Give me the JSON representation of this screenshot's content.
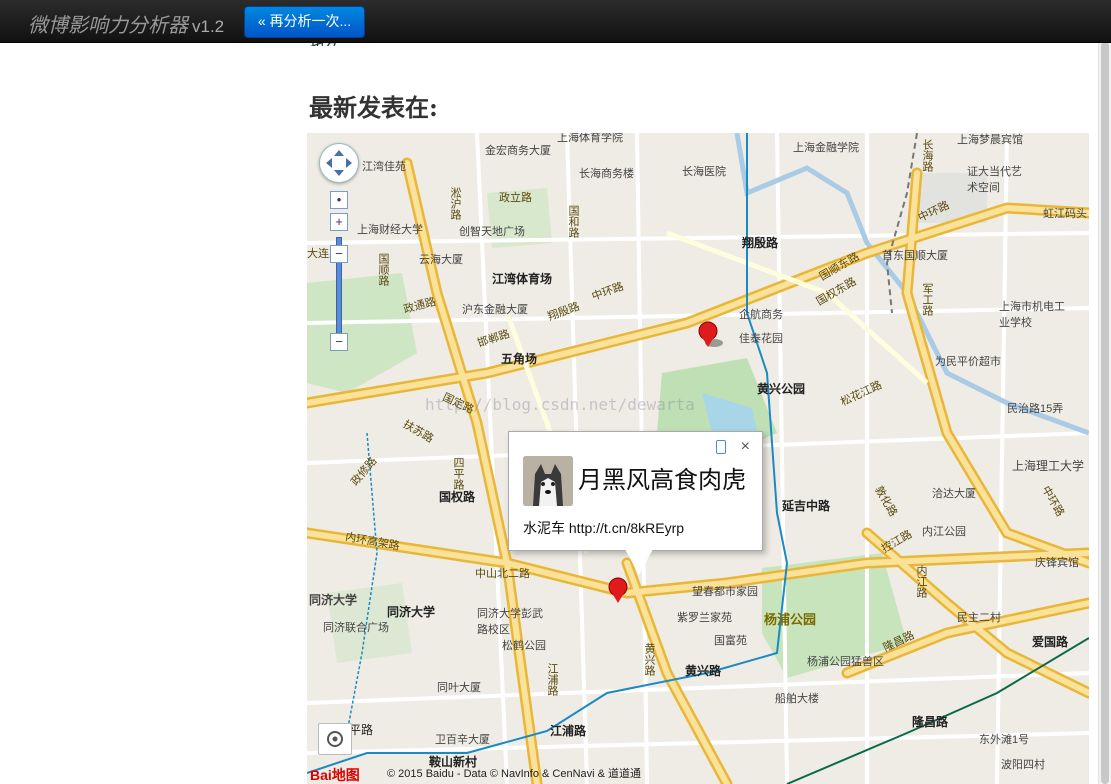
{
  "navbar": {
    "brand": "微博影响力分析器",
    "version": "v1.2",
    "again_button": "« 再分析一次..."
  },
  "page": {
    "cut_text": "也久",
    "section_title": "最新发表在:"
  },
  "map": {
    "watermark": "http://blog.csdn.net/dewarta",
    "pois": [
      "上海体育学院",
      "金宏商务大厦",
      "上海金融学院",
      "长海商务楼",
      "长海医院",
      "上海梦晨宾馆",
      "证大当代艺术空间",
      "江湾佳苑",
      "创智天地广场",
      "上海财经大学",
      "首东国顺大厦",
      "云海大厦",
      "沪东金融大厦",
      "企航商务",
      "佳泰花园",
      "上海市机电工业学校",
      "为民平价超市",
      "民治路15弄",
      "洽达大厦",
      "内江公园",
      "庆锋宾馆",
      "同济大学",
      "同济联合广场",
      "同济大学彭武路校区",
      "松鹤公园",
      "望春都市家园",
      "紫罗兰家苑",
      "国富苑",
      "杨浦公园",
      "杨浦公园猛兽区",
      "民主二村",
      "同叶大厦",
      "船舶大楼",
      "卫百辛大厦",
      "东外滩1号",
      "波阳四村",
      "虹江码头",
      "上海理工大学"
    ],
    "stations": [
      "江湾体育场",
      "五角场",
      "翔殷路",
      "黄兴公园",
      "国权路",
      "延吉中路",
      "黄兴路",
      "江浦路",
      "隆昌路",
      "鞍山新村",
      "爱国路",
      "同济大学"
    ],
    "roads": [
      "政立路",
      "国和路",
      "翔殷路",
      "中环路",
      "邯郸路",
      "四平路",
      "国定路",
      "松花江路",
      "内环高架路",
      "中山北二路",
      "黄兴路",
      "江浦路",
      "控江路",
      "内江路",
      "隆昌路",
      "国权东路",
      "敦化路",
      "淞沪路",
      "政通路",
      "政修路",
      "扶苏路",
      "国顺东路",
      "中环路",
      "国顺路",
      "平路",
      "长海路",
      "大连路",
      "军工路",
      "中环路"
    ],
    "parks": [
      "杨浦公园"
    ],
    "zoom_plus": "+",
    "zoom_minus": "−",
    "copyright": "© 2015 Baidu - Data © NavInfo & CenNavi & 道道通",
    "baidu_logo": "Bai地图"
  },
  "infowindow": {
    "username": "月黑风高食肉虎",
    "post": "水泥车 http://t.cn/8kREyrp",
    "close": "×"
  },
  "colors": {
    "navbar": "#1b1b1b",
    "button": "#0066cc",
    "road_major": "#f6c64a",
    "metro_line": "#1a8ac4",
    "station": "#d11111",
    "marker": "#e01b1b"
  }
}
